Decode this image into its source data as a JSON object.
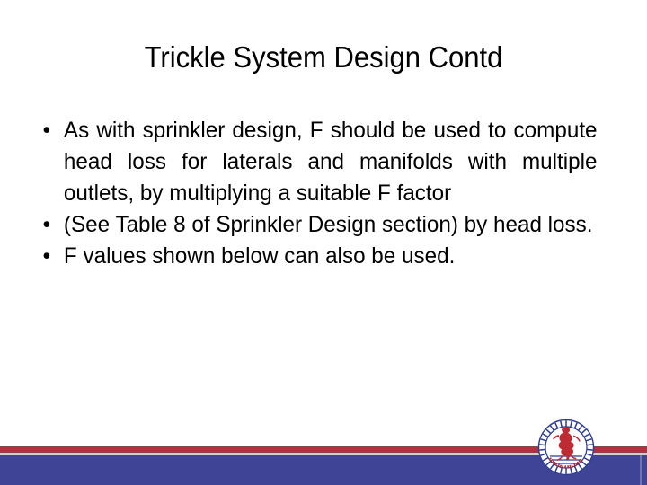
{
  "slide": {
    "title": "Trickle System Design Contd",
    "bullets": [
      {
        "marker": "•",
        "text": "As with sprinkler design, F should be used to compute head loss for laterals and manifolds with multiple outlets, by multiplying a suitable F factor",
        "align": "justify"
      },
      {
        "marker": "•",
        "text": "(See Table 8 of Sprinkler Design section) by head loss.",
        "align": "justify"
      },
      {
        "marker": "•",
        "text": "F values shown below can also be used.",
        "align": "left"
      }
    ]
  },
  "decoration": {
    "red_band_color": "#ad3341",
    "pink_band_color": "#d9c7d6",
    "blue_band_color": "#3f4496",
    "emblem": {
      "name": "university-seal-emblem",
      "ring_color": "#2c3b8f",
      "figure_color": "#bf2b33",
      "text_color": "#b4252e",
      "background_color": "#ffffff"
    }
  }
}
